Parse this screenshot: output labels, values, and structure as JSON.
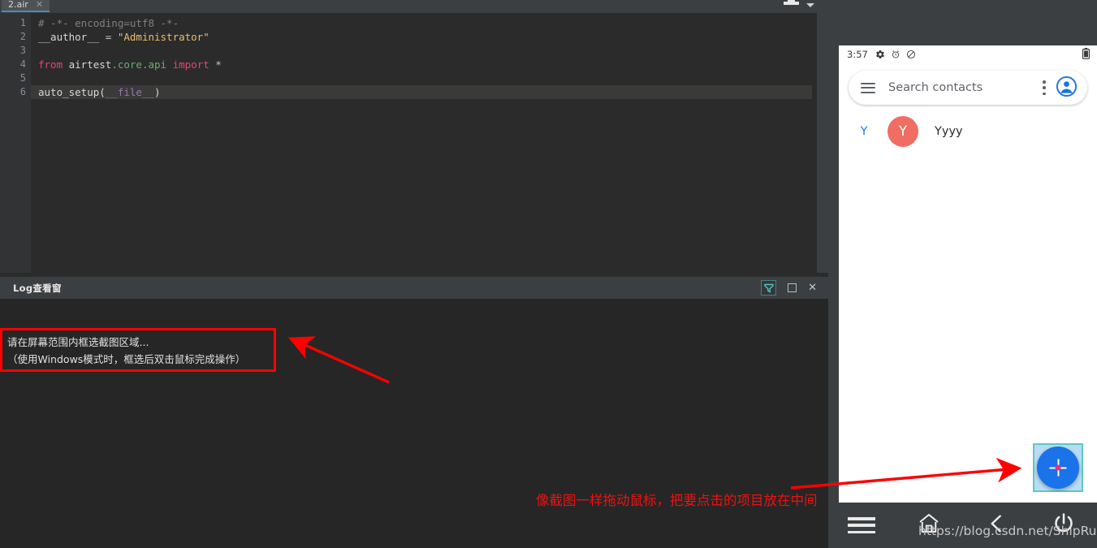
{
  "ide": {
    "tab": {
      "label": "2.air",
      "close_icon": "close-icon"
    },
    "tab_tools": {
      "pin_icon": "pin-icon",
      "chevron_icon": "chevron-down-icon"
    },
    "editor": {
      "line_numbers": [
        "1",
        "2",
        "3",
        "4",
        "5",
        "6"
      ],
      "lines": [
        {
          "n": "1",
          "text": "# -*- encoding=utf8 -*-",
          "highlighted": false
        },
        {
          "n": "2",
          "text": "__author__ = \"Administrator\"",
          "highlighted": false
        },
        {
          "n": "3",
          "text": "",
          "highlighted": false
        },
        {
          "n": "4",
          "text": "from airtest.core.api import *",
          "highlighted": false
        },
        {
          "n": "5",
          "text": "",
          "highlighted": false
        },
        {
          "n": "6",
          "text": "auto_setup(__file__)",
          "highlighted": true
        }
      ],
      "tokens": {
        "l1_comment": "# -*- encoding=utf8 -*-",
        "l2_ident": "__author__",
        "l2_eq": " = ",
        "l2_str": "\"Administrator\"",
        "l4_from": "from",
        "l4_mod": " airtest",
        "l4_attr": ".core.api",
        "l4_import": " import",
        "l4_star": " *",
        "l6_fn": "auto_setup(",
        "l6_arg": "__file__",
        "l6_close": ")"
      }
    },
    "log_panel": {
      "title": "Log查看窗",
      "tools": {
        "filter_icon": "filter-icon",
        "maximize_icon": "maximize-icon",
        "close_icon": "close-icon"
      },
      "notice": {
        "line1": "请在屏幕范围内框选截图区域...",
        "line2": "（使用Windows模式时，框选后双击鼠标完成操作）"
      }
    }
  },
  "annotation": {
    "text": "像截图一样拖动鼠标，把要点击的项目放在中间",
    "color": "#ee1111",
    "arrow_color": "#fe0000"
  },
  "phone": {
    "status_bar": {
      "time": "3:57",
      "icons": [
        "gear-icon",
        "alarm-icon",
        "do-not-disturb-icon"
      ],
      "battery_icon": "battery-icon"
    },
    "search": {
      "menu_icon": "hamburger-menu-icon",
      "placeholder": "Search contacts",
      "overflow_icon": "kebab-menu-icon",
      "account_icon": "account-avatar-icon"
    },
    "contacts": {
      "section_letter": "Y",
      "items": [
        {
          "avatar_letter": "Y",
          "name": "Yyyy",
          "avatar_color": "#ef6d62"
        }
      ]
    },
    "fab": {
      "icon": "crosshair-target-icon",
      "color": "#1a73e8",
      "selection_border_color": "#5fc8c0"
    },
    "nav_bar": {
      "items": [
        "menu-icon",
        "home-icon",
        "back-icon",
        "power-icon"
      ]
    }
  },
  "watermark": {
    "text": "https://blog.csdn.net/ShipRun"
  }
}
